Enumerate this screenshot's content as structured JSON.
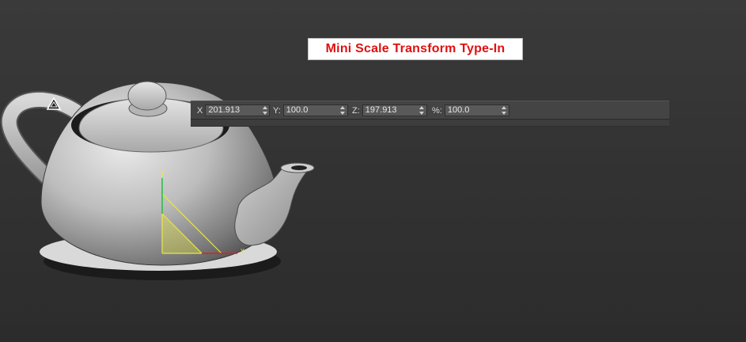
{
  "title_banner": "Mini Scale Transform Type-In",
  "typein": {
    "fields": [
      {
        "label": "X",
        "value": "201.913"
      },
      {
        "label": "Y:",
        "value": "100.0"
      },
      {
        "label": "Z:",
        "value": "197.913"
      },
      {
        "label": "%:",
        "value": "100.0"
      }
    ]
  },
  "gizmo": {
    "x_axis_label": "x",
    "y_axis_label": "y"
  },
  "colors": {
    "banner_text": "#e01010",
    "gizmo_x_axis": "#e02020",
    "gizmo_y_axis": "#20c040",
    "gizmo_plane": "#e8e840"
  },
  "icons": [
    "viewport-triangle-icon",
    "spinner-arrows-icon"
  ]
}
